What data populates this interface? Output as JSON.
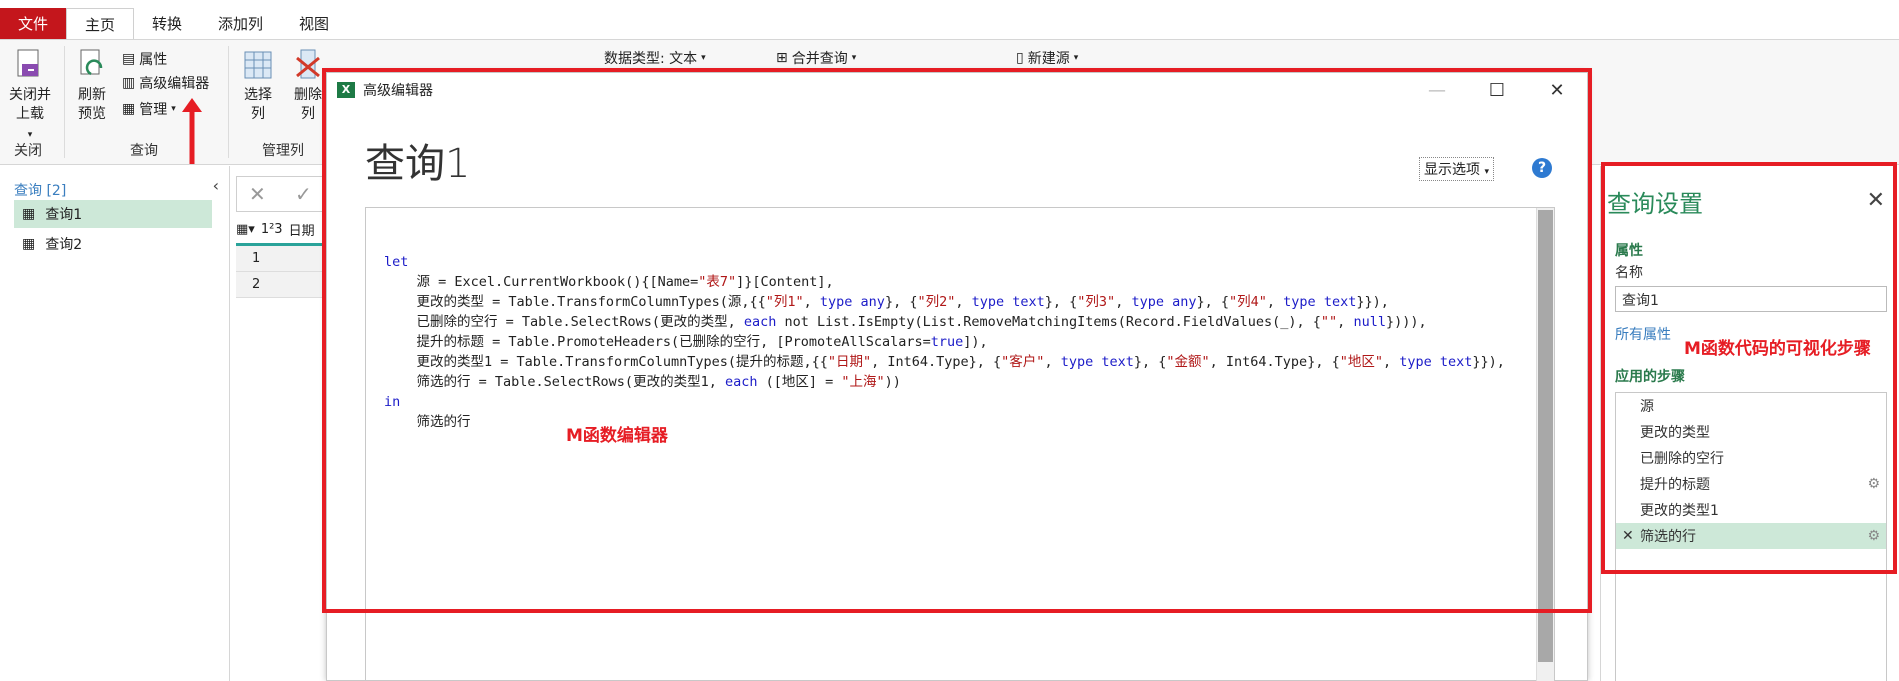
{
  "ribbon": {
    "tabs": [
      "文件",
      "主页",
      "转换",
      "添加列",
      "视图"
    ],
    "active_tab": "主页",
    "close_load_label": "关闭并上载",
    "close_group": "关闭",
    "refresh_label": "刷新预览",
    "properties_label": "属性",
    "advanced_editor_label": "高级编辑器",
    "manage_label": "管理",
    "query_group": "查询",
    "choose_cols_label": "选择列",
    "remove_cols_label": "删除列",
    "manage_cols_group": "管理列",
    "data_type_label": "数据类型: 文本",
    "merge_query_label": "合并查询",
    "new_source_label": "新建源"
  },
  "queries_pane": {
    "header": "查询 [2]",
    "items": [
      "查询1",
      "查询2"
    ],
    "selected": "查询1"
  },
  "grid_fragment": {
    "col_header": "日期",
    "rows": [
      "1",
      "2"
    ]
  },
  "editor": {
    "window_title": "高级编辑器",
    "query_title": "查询1",
    "show_options": "显示选项",
    "help": "?",
    "code_lines": [
      "let",
      "    源 = Excel.CurrentWorkbook(){[Name=\"表7\"]}[Content],",
      "    更改的类型 = Table.TransformColumnTypes(源,{{\"列1\", type any}, {\"列2\", type text}, {\"列3\", type any}, {\"列4\", type text}}),",
      "    已删除的空行 = Table.SelectRows(更改的类型, each not List.IsEmpty(List.RemoveMatchingItems(Record.FieldValues(_), {\"\", null}))),",
      "    提升的标题 = Table.PromoteHeaders(已删除的空行, [PromoteAllScalars=true]),",
      "    更改的类型1 = Table.TransformColumnTypes(提升的标题,{{\"日期\", Int64.Type}, {\"客户\", type text}, {\"金额\", Int64.Type}, {\"地区\", type text}}),",
      "    筛选的行 = Table.SelectRows(更改的类型1, each ([地区] = \"上海\"))",
      "in",
      "    筛选的行"
    ]
  },
  "settings": {
    "title": "查询设置",
    "properties_section": "属性",
    "name_label": "名称",
    "name_value": "查询1",
    "all_properties": "所有属性",
    "steps_section": "应用的步骤",
    "steps": [
      "源",
      "更改的类型",
      "已删除的空行",
      "提升的标题",
      "更改的类型1",
      "筛选的行"
    ],
    "selected_step": "筛选的行"
  },
  "annotations": {
    "editor_note": "M函数编辑器",
    "steps_note": "M函数代码的可视化步骤"
  },
  "colors": {
    "accent_red": "#e61d24",
    "file_tab": "#c4161c",
    "selection_green": "#cde8d8",
    "settings_green": "#2a8a5a"
  }
}
